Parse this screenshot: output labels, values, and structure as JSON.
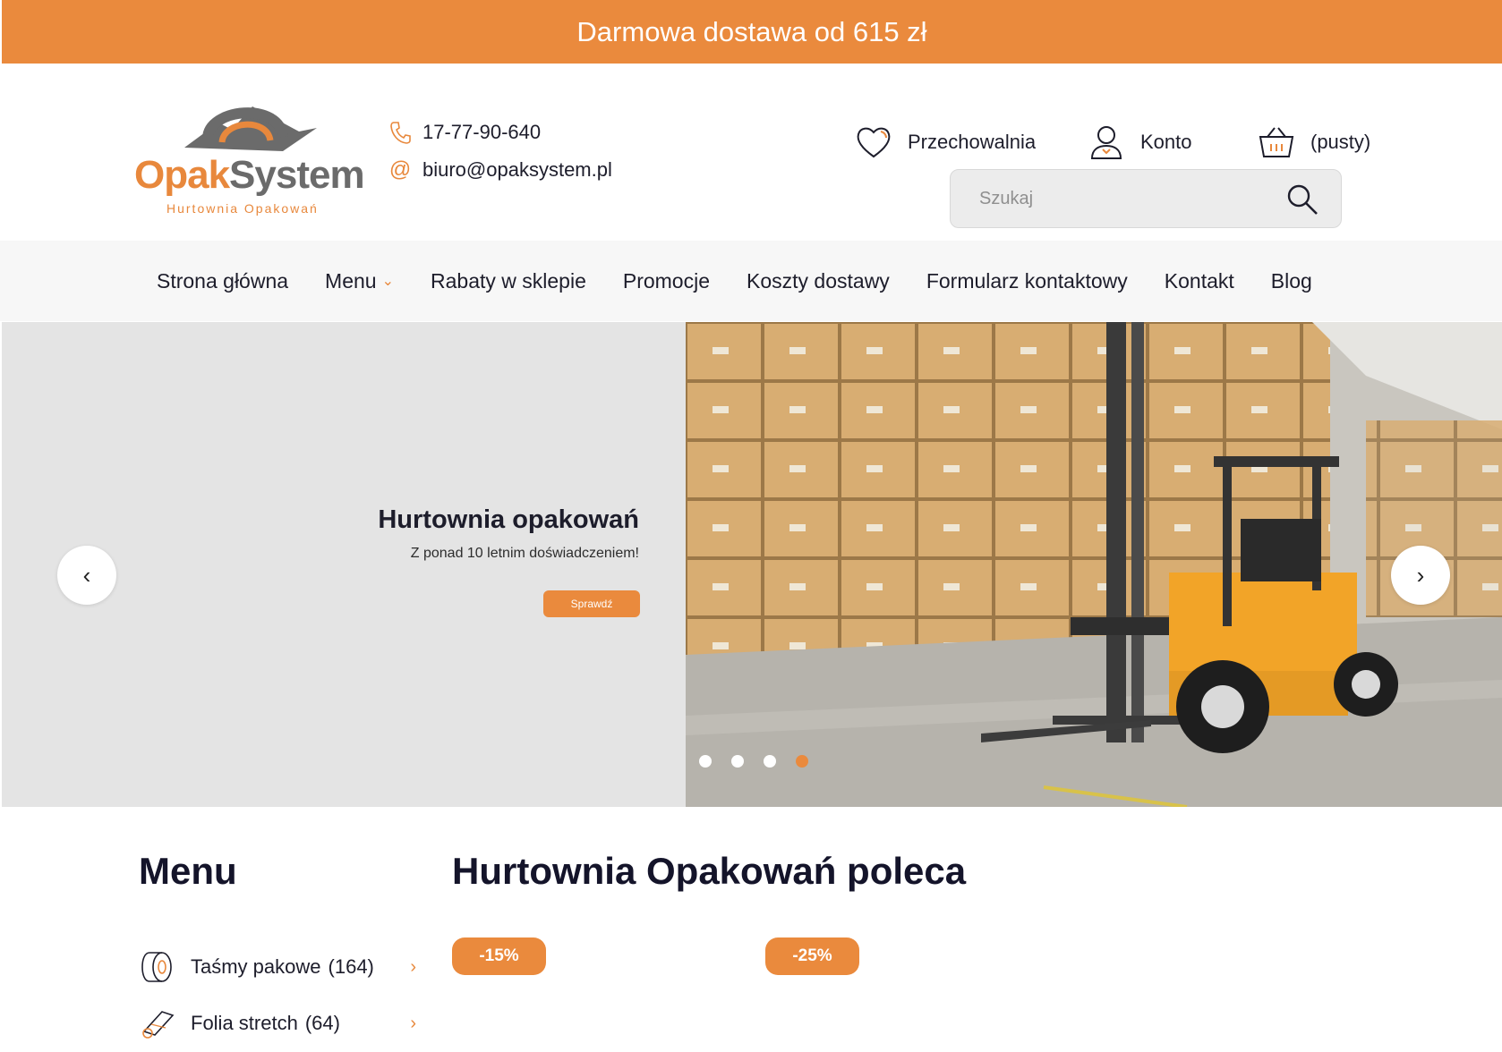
{
  "promo": {
    "text": "Darmowa dostawa od 615 zł"
  },
  "logo": {
    "brand_part1": "Opak",
    "brand_part2": "System",
    "tagline": "Hurtownia Opakowań"
  },
  "contact": {
    "phone": "17-77-90-640",
    "email": "biuro@opaksystem.pl"
  },
  "header_links": {
    "storage": "Przechowalnia",
    "account": "Konto",
    "cart": "(pusty)"
  },
  "search": {
    "placeholder": "Szukaj"
  },
  "nav": {
    "items": [
      {
        "label": "Strona główna"
      },
      {
        "label": "Menu"
      },
      {
        "label": "Rabaty w sklepie"
      },
      {
        "label": "Promocje"
      },
      {
        "label": "Koszty dostawy"
      },
      {
        "label": "Formularz kontaktowy"
      },
      {
        "label": "Kontakt"
      },
      {
        "label": "Blog"
      }
    ]
  },
  "hero": {
    "title": "Hurtownia opakowań",
    "subtitle": "Z ponad 10 letnim doświadczeniem!",
    "button": "Sprawdź",
    "slides_count": 4,
    "active_slide": 4
  },
  "sidebar": {
    "title": "Menu",
    "categories": [
      {
        "label": "Taśmy pakowe",
        "count": "(164)"
      },
      {
        "label": "Folia stretch",
        "count": "(64)"
      }
    ]
  },
  "recommended": {
    "title": "Hurtownia Opakowań poleca",
    "badges": [
      "-15%",
      "-25%"
    ]
  },
  "colors": {
    "accent": "#ea8a3d",
    "text": "#1d1d2b",
    "logo_gray": "#6b6b6b"
  }
}
